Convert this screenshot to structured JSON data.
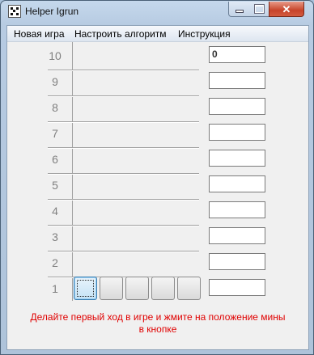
{
  "window": {
    "title": "Helper Igrun",
    "icon": "dice-icon",
    "controls": [
      "minimize-icon",
      "maximize-icon",
      "close-icon"
    ],
    "close_glyph": "✕"
  },
  "menu": {
    "items": [
      "Новая игра",
      "Настроить алгоритм",
      "Инструкция"
    ]
  },
  "grid": {
    "rows": [
      {
        "label": "10",
        "value": "0"
      },
      {
        "label": "9",
        "value": ""
      },
      {
        "label": "8",
        "value": ""
      },
      {
        "label": "7",
        "value": ""
      },
      {
        "label": "6",
        "value": ""
      },
      {
        "label": "5",
        "value": ""
      },
      {
        "label": "4",
        "value": ""
      },
      {
        "label": "3",
        "value": ""
      },
      {
        "label": "2",
        "value": ""
      },
      {
        "label": "1",
        "value": ""
      }
    ],
    "buttons_in_row_1": 5
  },
  "status": {
    "line1": "Делайте первый ход в игре и жмите на положение мины",
    "line2": "в кнопке",
    "color": "#e00000"
  }
}
